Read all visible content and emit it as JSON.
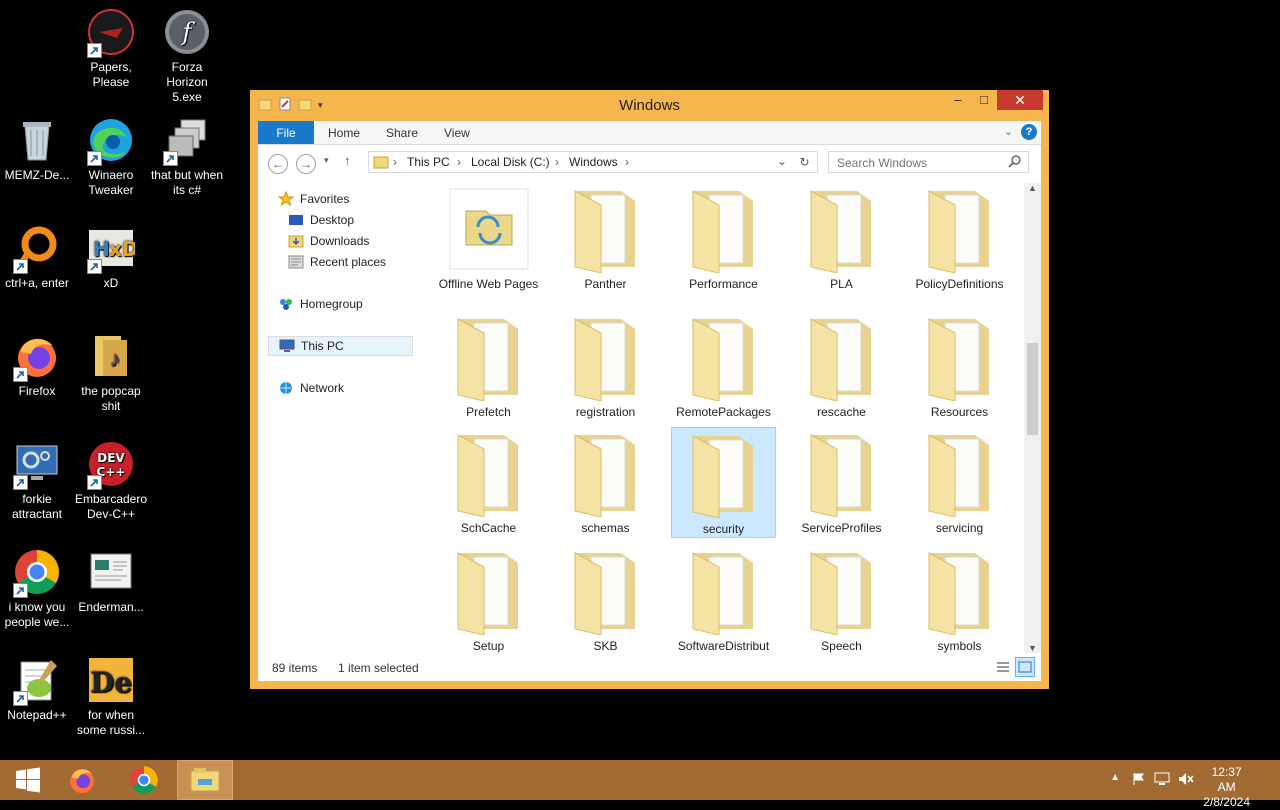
{
  "desktop": {
    "icons": [
      {
        "label": "Papers, Please"
      },
      {
        "label": "Forza Horizon 5.exe"
      },
      {
        "label": "MEMZ-De..."
      },
      {
        "label": "Winaero Tweaker"
      },
      {
        "label": "that but when its c#"
      },
      {
        "label": "ctrl+a, enter"
      },
      {
        "label": "xD"
      },
      {
        "label": "Firefox"
      },
      {
        "label": "the popcap shit"
      },
      {
        "label": "forkie attractant"
      },
      {
        "label": "Embarcadero Dev-C++"
      },
      {
        "label": "i know you people we..."
      },
      {
        "label": "Enderman..."
      },
      {
        "label": "Notepad++"
      },
      {
        "label": "for when some russi..."
      }
    ]
  },
  "window": {
    "title": "Windows",
    "minimize": "–",
    "maximize": "□",
    "close": "✕",
    "ribbon_tabs": [
      "File",
      "Home",
      "Share",
      "View"
    ],
    "breadcrumb": [
      "This PC",
      "Local Disk (C:)",
      "Windows"
    ],
    "search_placeholder": "Search Windows",
    "nav": {
      "favorites": "Favorites",
      "desktop": "Desktop",
      "downloads": "Downloads",
      "recent": "Recent places",
      "homegroup": "Homegroup",
      "thispc": "This PC",
      "network": "Network"
    },
    "folders": [
      "Offline Web Pages",
      "Panther",
      "Performance",
      "PLA",
      "PolicyDefinitions",
      "Prefetch",
      "registration",
      "RemotePackages",
      "rescache",
      "Resources",
      "SchCache",
      "schemas",
      "security",
      "ServiceProfiles",
      "servicing",
      "Setup",
      "SKB",
      "SoftwareDistribut",
      "Speech",
      "symbols"
    ],
    "selected_folder": "security",
    "status": {
      "count": "89 items",
      "selection": "1 item selected"
    }
  },
  "taskbar": {
    "time": "12:37 AM",
    "date": "2/8/2024"
  },
  "colors": {
    "window_frame": "#f6b64e",
    "taskbar": "#a36b34",
    "file_tab": "#1979ca",
    "close_button": "#c7382d",
    "selection": "#cce8ff"
  }
}
